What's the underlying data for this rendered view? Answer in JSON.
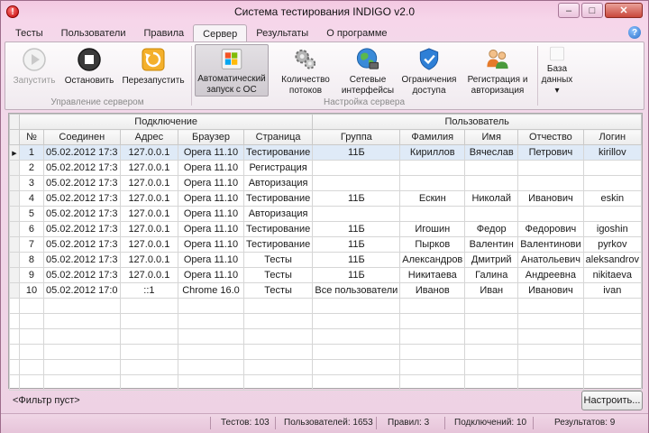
{
  "window": {
    "title": "Система тестирования INDIGO v2.0",
    "app_icon_glyph": "!"
  },
  "window_controls": {
    "minimize": "–",
    "maximize": "□",
    "close": "✕"
  },
  "menu_tabs": [
    {
      "label": "Тесты",
      "active": false
    },
    {
      "label": "Пользователи",
      "active": false
    },
    {
      "label": "Правила",
      "active": false
    },
    {
      "label": "Сервер",
      "active": true
    },
    {
      "label": "Результаты",
      "active": false
    },
    {
      "label": "О программе",
      "active": false
    }
  ],
  "help": {
    "glyph": "?"
  },
  "ribbon": {
    "server_control": {
      "group_label": "Управление сервером",
      "start": {
        "label": "Запустить",
        "icon": "play-icon",
        "enabled": false
      },
      "stop": {
        "label": "Остановить",
        "icon": "stop-icon",
        "enabled": true
      },
      "restart": {
        "label": "Перезапустить",
        "icon": "restart-icon",
        "enabled": true
      }
    },
    "server_settings": {
      "group_label": "Настройка сервера",
      "autostart": {
        "line1": "Автоматический",
        "line2": "запуск с ОС",
        "icon": "windows-logo-icon",
        "pressed": true
      },
      "threads": {
        "line1": "Количество",
        "line2": "потоков",
        "icon": "gears-icon"
      },
      "interfaces": {
        "line1": "Сетевые",
        "line2": "интерфейсы",
        "icon": "globe-network-icon"
      },
      "access": {
        "line1": "Ограничения",
        "line2": "доступа",
        "icon": "shield-icon"
      },
      "auth": {
        "line1": "Регистрация и",
        "line2": "авторизация",
        "icon": "users-icon"
      }
    },
    "database": {
      "line1": "База",
      "line2": "данных",
      "icon": "database-icon",
      "dropdown": "▾"
    }
  },
  "grid": {
    "group_headers": {
      "connection": "Подключение",
      "user": "Пользователь"
    },
    "columns": [
      "№",
      "Соединен",
      "Адрес",
      "Браузер",
      "Страница",
      "Группа",
      "Фамилия",
      "Имя",
      "Отчество",
      "Логин"
    ],
    "current_row_marker": "▶",
    "rows": [
      [
        "1",
        "05.02.2012 17:3",
        "127.0.0.1",
        "Opera 11.10",
        "Тестирование",
        "11Б",
        "Кириллов",
        "Вячеслав",
        "Петрович",
        "kirillov"
      ],
      [
        "2",
        "05.02.2012 17:3",
        "127.0.0.1",
        "Opera 11.10",
        "Регистрация",
        "",
        "",
        "",
        "",
        ""
      ],
      [
        "3",
        "05.02.2012 17:3",
        "127.0.0.1",
        "Opera 11.10",
        "Авторизация",
        "",
        "",
        "",
        "",
        ""
      ],
      [
        "4",
        "05.02.2012 17:3",
        "127.0.0.1",
        "Opera 11.10",
        "Тестирование",
        "11Б",
        "Ескин",
        "Николай",
        "Иванович",
        "eskin"
      ],
      [
        "5",
        "05.02.2012 17:3",
        "127.0.0.1",
        "Opera 11.10",
        "Авторизация",
        "",
        "",
        "",
        "",
        ""
      ],
      [
        "6",
        "05.02.2012 17:3",
        "127.0.0.1",
        "Opera 11.10",
        "Тестирование",
        "11Б",
        "Игошин",
        "Федор",
        "Федорович",
        "igoshin"
      ],
      [
        "7",
        "05.02.2012 17:3",
        "127.0.0.1",
        "Opera 11.10",
        "Тестирование",
        "11Б",
        "Пырков",
        "Валентин",
        "Валентинови",
        "pyrkov"
      ],
      [
        "8",
        "05.02.2012 17:3",
        "127.0.0.1",
        "Opera 11.10",
        "Тесты",
        "11Б",
        "Александров",
        "Дмитрий",
        "Анатольевич",
        "aleksandrov"
      ],
      [
        "9",
        "05.02.2012 17:3",
        "127.0.0.1",
        "Opera 11.10",
        "Тесты",
        "11Б",
        "Никитаева",
        "Галина",
        "Андреевна",
        "nikitaeva"
      ],
      [
        "10",
        "05.02.2012 17:0",
        "::1",
        "Chrome 16.0",
        "Тесты",
        "Все пользователи",
        "Иванов",
        "Иван",
        "Иванович",
        "ivan"
      ]
    ]
  },
  "filter": {
    "text": "<Фильтр пуст>",
    "configure_label": "Настроить..."
  },
  "status": {
    "tests": "Тестов: 103",
    "users": "Пользователей: 1653",
    "rules": "Правил: 3",
    "connections": "Подключений: 10",
    "results": "Результатов: 9"
  }
}
